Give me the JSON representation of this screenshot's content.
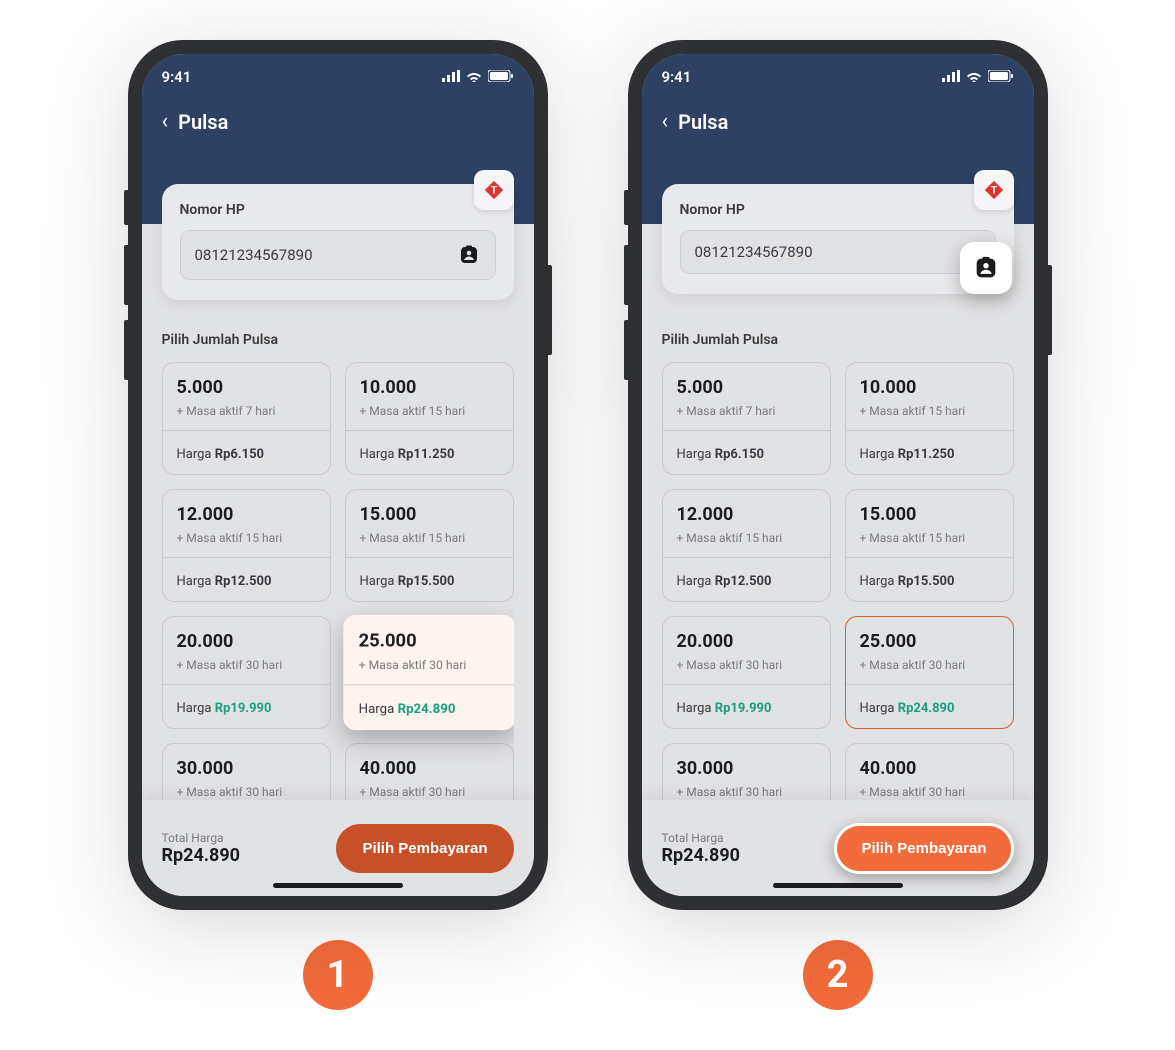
{
  "status": {
    "time": "9:41"
  },
  "nav": {
    "title": "Pulsa"
  },
  "input": {
    "label": "Nomor HP",
    "value": "08121234567890"
  },
  "section_title": "Pilih Jumlah Pulsa",
  "validity_prefix": "+ Masa aktif ",
  "validity_suffix": " hari",
  "price_label": "Harga ",
  "options": [
    {
      "amount": "5.000",
      "days": "7",
      "price": "Rp6.150",
      "highlight": false
    },
    {
      "amount": "10.000",
      "days": "15",
      "price": "Rp11.250",
      "highlight": false
    },
    {
      "amount": "12.000",
      "days": "15",
      "price": "Rp12.500",
      "highlight": false
    },
    {
      "amount": "15.000",
      "days": "15",
      "price": "Rp15.500",
      "highlight": false
    },
    {
      "amount": "20.000",
      "days": "30",
      "price": "Rp19.990",
      "highlight": true
    },
    {
      "amount": "25.000",
      "days": "30",
      "price": "Rp24.890",
      "highlight": true
    },
    {
      "amount": "30.000",
      "days": "30",
      "price": "",
      "highlight": false
    },
    {
      "amount": "40.000",
      "days": "30",
      "price": "",
      "highlight": false
    }
  ],
  "selected_index": 5,
  "total": {
    "label": "Total Harga",
    "value": "Rp24.890"
  },
  "cta": "Pilih Pembayaran",
  "badges": {
    "first": "1",
    "second": "2"
  }
}
